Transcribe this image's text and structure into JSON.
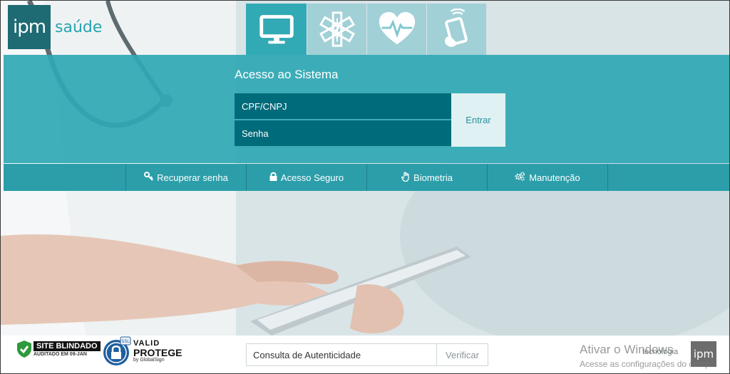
{
  "header": {
    "logo_mark": "ipm",
    "logo_text": "saúde",
    "tabs": [
      {
        "icon": "monitor-icon",
        "active": true
      },
      {
        "icon": "medical-star-icon",
        "active": false
      },
      {
        "icon": "heart-pulse-icon",
        "active": false
      },
      {
        "icon": "mobile-signal-icon",
        "active": false
      }
    ]
  },
  "login": {
    "title": "Acesso ao Sistema",
    "cpf_placeholder": "CPF/CNPJ",
    "password_placeholder": "Senha",
    "enter_label": "Entrar"
  },
  "quick_links": [
    {
      "label": "Recuperar senha",
      "icon": "key-icon"
    },
    {
      "label": "Acesso Seguro",
      "icon": "lock-icon"
    },
    {
      "label": "Biometria",
      "icon": "hand-icon"
    },
    {
      "label": "Manutenção",
      "icon": "gears-icon"
    }
  ],
  "footer": {
    "seal_blindado": {
      "main": "SITE BLINDADO",
      "sub": "AUDITADO EM 09-JAN"
    },
    "seal_valid": {
      "line1": "VALID",
      "line2": "PROTEGE",
      "line3": "by GlobalSign",
      "ssl": "SSL"
    },
    "auth_placeholder": "Consulta de Autenticidade",
    "verify_label": "Verificar",
    "brand_small": "tecnologia",
    "ipm_mini": "ipm"
  },
  "windows_watermark": {
    "title": "Ativar o Windows",
    "subtitle": "Acesse as configurações do comp"
  },
  "colors": {
    "teal_band": "#2fa8b4",
    "dark_field": "#006b7a",
    "logo_bg": "#1e6b74",
    "logo_text": "#2aa3b0"
  }
}
